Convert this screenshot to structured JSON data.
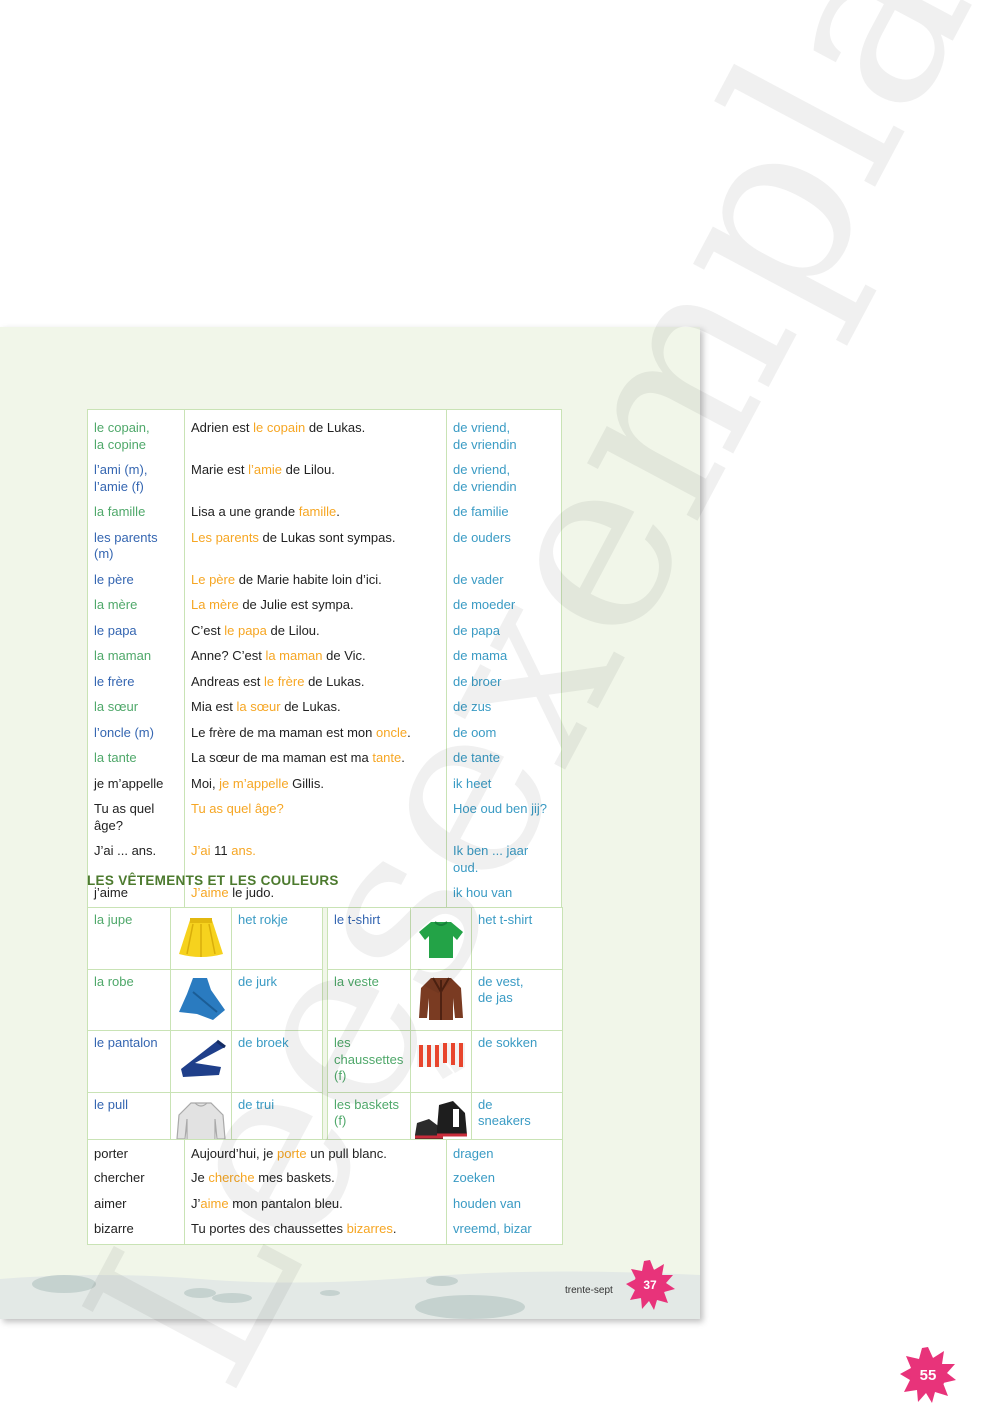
{
  "vocab": [
    {
      "fr_lines": [
        "le copain,",
        "la copine"
      ],
      "fr_color": "green",
      "sentence": [
        {
          "t": "Adrien est "
        },
        {
          "t": "le copain",
          "h": 1
        },
        {
          "t": " de Lukas."
        }
      ],
      "nl_lines": [
        "de vriend,",
        "de vriendin"
      ]
    },
    {
      "fr_lines": [
        "l’ami (m),",
        "l’amie (f)"
      ],
      "fr_color": "blue",
      "sentence": [
        {
          "t": "Marie est "
        },
        {
          "t": "l’amie",
          "h": 1
        },
        {
          "t": " de Lilou."
        }
      ],
      "nl_lines": [
        "de vriend,",
        "de vriendin"
      ]
    },
    {
      "fr_lines": [
        "la famille"
      ],
      "fr_color": "green",
      "sentence": [
        {
          "t": "Lisa a une grande "
        },
        {
          "t": "famille",
          "h": 1
        },
        {
          "t": "."
        }
      ],
      "nl_lines": [
        "de familie"
      ]
    },
    {
      "fr_lines": [
        "les parents (m)"
      ],
      "fr_color": "blue",
      "sentence": [
        {
          "t": "Les parents",
          "h": 1
        },
        {
          "t": " de Lukas sont sympas."
        }
      ],
      "nl_lines": [
        "de ouders"
      ]
    },
    {
      "fr_lines": [
        "le père"
      ],
      "fr_color": "blue",
      "sentence": [
        {
          "t": "Le père",
          "h": 1
        },
        {
          "t": " de Marie habite loin d’ici."
        }
      ],
      "nl_lines": [
        "de vader"
      ]
    },
    {
      "fr_lines": [
        "la mère"
      ],
      "fr_color": "green",
      "sentence": [
        {
          "t": "La mère",
          "h": 1
        },
        {
          "t": " de Julie est sympa."
        }
      ],
      "nl_lines": [
        "de moeder"
      ]
    },
    {
      "fr_lines": [
        "le papa"
      ],
      "fr_color": "blue",
      "sentence": [
        {
          "t": "C’est "
        },
        {
          "t": "le papa",
          "h": 1
        },
        {
          "t": " de Lilou."
        }
      ],
      "nl_lines": [
        "de papa"
      ]
    },
    {
      "fr_lines": [
        "la maman"
      ],
      "fr_color": "green",
      "sentence": [
        {
          "t": "Anne? C’est "
        },
        {
          "t": "la maman",
          "h": 1
        },
        {
          "t": " de Vic."
        }
      ],
      "nl_lines": [
        "de mama"
      ]
    },
    {
      "fr_lines": [
        "le frère"
      ],
      "fr_color": "blue",
      "sentence": [
        {
          "t": "Andreas est "
        },
        {
          "t": "le frère",
          "h": 1
        },
        {
          "t": " de Lukas."
        }
      ],
      "nl_lines": [
        "de broer"
      ]
    },
    {
      "fr_lines": [
        "la sœur"
      ],
      "fr_color": "green",
      "sentence": [
        {
          "t": "Mia est "
        },
        {
          "t": "la sœur",
          "h": 1
        },
        {
          "t": " de Lukas."
        }
      ],
      "nl_lines": [
        "de zus"
      ]
    },
    {
      "fr_lines": [
        "l’oncle (m)"
      ],
      "fr_color": "blue",
      "sentence": [
        {
          "t": "Le frère de ma maman est mon "
        },
        {
          "t": "oncle",
          "h": 1
        },
        {
          "t": "."
        }
      ],
      "nl_lines": [
        "de oom"
      ]
    },
    {
      "fr_lines": [
        "la tante"
      ],
      "fr_color": "green",
      "sentence": [
        {
          "t": "La sœur de ma maman est ma "
        },
        {
          "t": "tante",
          "h": 1
        },
        {
          "t": "."
        }
      ],
      "nl_lines": [
        "de tante"
      ]
    },
    {
      "fr_lines": [
        "je m’appelle"
      ],
      "fr_color": "dark",
      "sentence": [
        {
          "t": "Moi, "
        },
        {
          "t": "je m’appelle",
          "h": 1
        },
        {
          "t": " Gillis."
        }
      ],
      "nl_lines": [
        "ik heet"
      ]
    },
    {
      "fr_lines": [
        "Tu as quel âge?"
      ],
      "fr_color": "dark",
      "sentence": [
        {
          "t": "Tu as quel âge?",
          "h": 1
        }
      ],
      "nl_lines": [
        "Hoe oud ben jij?"
      ]
    },
    {
      "fr_lines": [
        "J’ai ... ans."
      ],
      "fr_color": "dark",
      "sentence": [
        {
          "t": "J’ai",
          "h": 1
        },
        {
          "t": " 11 "
        },
        {
          "t": "ans.",
          "h": 1
        }
      ],
      "nl_lines": [
        "Ik ben ... jaar oud."
      ]
    },
    {
      "fr_lines": [
        "j’aime"
      ],
      "fr_color": "dark",
      "sentence": [
        {
          "t": "J’aime",
          "h": 1
        },
        {
          "t": " le judo."
        }
      ],
      "nl_lines": [
        "ik hou van"
      ]
    }
  ],
  "clothes_heading": "LES VÊTEMENTS ET LES COULEURS",
  "clothes_left": [
    {
      "fr": "la jupe",
      "color": "green",
      "nl": "het rokje",
      "icon": "skirt-icon"
    },
    {
      "fr": "la robe",
      "color": "green",
      "nl": "de jurk",
      "icon": "dress-icon"
    },
    {
      "fr": "le pantalon",
      "color": "blue",
      "nl": "de broek",
      "icon": "trousers-icon"
    },
    {
      "fr": "le pull",
      "color": "blue",
      "nl": "de trui",
      "icon": "sweater-icon"
    }
  ],
  "clothes_right": [
    {
      "fr": "le t-shirt",
      "color": "blue",
      "nl_lines": [
        "het t-shirt"
      ],
      "icon": "tshirt-icon"
    },
    {
      "fr": "la veste",
      "color": "green",
      "nl_lines": [
        "de vest,",
        "de jas"
      ],
      "icon": "jacket-icon"
    },
    {
      "fr": "les chaussettes (f)",
      "color": "green",
      "nl_lines": [
        "de sokken"
      ],
      "icon": "socks-icon"
    },
    {
      "fr": "les baskets (f)",
      "color": "green",
      "nl_lines": [
        "de",
        "sneakers"
      ],
      "icon": "sneakers-icon"
    }
  ],
  "verbs": [
    {
      "fr": "porter",
      "sentence": [
        {
          "t": "Aujourd’hui, je "
        },
        {
          "t": "porte",
          "h": 1
        },
        {
          "t": " un pull blanc."
        }
      ],
      "nl": "dragen"
    },
    {
      "fr": "chercher",
      "sentence": [
        {
          "t": "Je "
        },
        {
          "t": "cherche",
          "h": 1
        },
        {
          "t": " mes baskets."
        }
      ],
      "nl": "zoeken"
    },
    {
      "fr": "aimer",
      "sentence": [
        {
          "t": "J’"
        },
        {
          "t": "aime",
          "h": 1
        },
        {
          "t": " mon pantalon bleu."
        }
      ],
      "nl": "houden van"
    },
    {
      "fr": "bizarre",
      "sentence": [
        {
          "t": "Tu portes des chaussettes "
        },
        {
          "t": "bizarres",
          "h": 1
        },
        {
          "t": "."
        }
      ],
      "nl": "vreemd, bizar"
    }
  ],
  "footer_text": "trente-sept",
  "page_badge_inner": "37",
  "page_badge_outer": "55",
  "watermark_text": "Leesexemplaar",
  "colors": {
    "accent_pink": "#e8337a",
    "highlight": "#f6a623",
    "fr_blue": "#3566b1",
    "fr_green": "#4fa86a",
    "nl_blue": "#3a9bc4"
  }
}
